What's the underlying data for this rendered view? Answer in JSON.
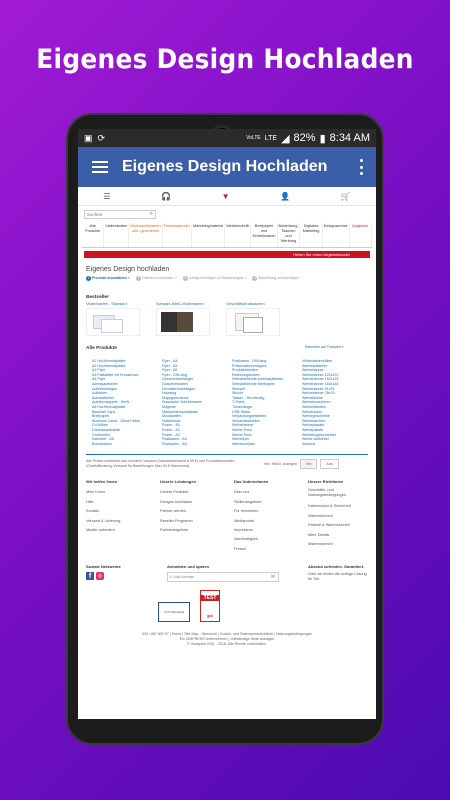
{
  "headline": "Eigenes Design Hochladen",
  "status": {
    "carrier": "VoLTE",
    "net": "LTE",
    "battery": "82%",
    "time": "8:34 AM"
  },
  "appbar": {
    "title": "Eigenes Design Hochladen"
  },
  "web": {
    "search_placeholder": "Suchen",
    "categories": [
      "Alle Produkte",
      "Visitenkarten",
      "Weihnachtskarten und -geschenke",
      "Firmenkalender",
      "Marketingmaterial",
      "Werbetechnik",
      "Briefpapier und Schreibwaren",
      "Bekleidung, Taschen und Werbung",
      "Digitales Marketing",
      "Designservice",
      "Angebote"
    ],
    "promo": "Heben Sie einen Angebotscode!",
    "page_heading": "Eigenes Design hochladen",
    "steps": [
      "Produkt auswählen",
      "Dateien hochladen",
      "Design/Vorlagen & Bestellungen",
      "Bestellung verständigen"
    ],
    "rating_link": "Bewerten auf Trustpilot »",
    "best_title": "Bestseller",
    "best": [
      "Visitenkarten - Standard",
      "Schwarz-Weiß-Visitenkarten",
      "Geschäftsdrucksachen"
    ],
    "all_title": "Alle Produkte",
    "col1": [
      "A1 Hochformatplakte",
      "A2 Hochformatplakte",
      "A3 Flyer",
      "A3 Faltblätter mit Kreuzbruch",
      "A4 Flyer",
      "Adressaufkleber",
      "Aufkleberbögen",
      "Aufkleber",
      "Autoaufkleber",
      "Autotürmagnete - Weiß",
      "A5 Hochformatplakte",
      "Baseball Caps",
      "Briefpapier",
      "Business Cards - Gloss Finish",
      "Cd-Hüllen",
      "Dreiecksaufsteller",
      "Grußkarten",
      "Kalender - A6",
      "Bonuskarten"
    ],
    "col2": [
      "Flyer - A4",
      "Flyer - A5",
      "Flyer - A6",
      "Flyer - DIN lang",
      "Geschenkanhänger",
      "Gutscheinkarten",
      "Hemdkartonbeilagen",
      "Holzartig",
      "Klappgutscheine",
      "Klassische Schreibwaren",
      "Magnete",
      "Markenstempelplakate",
      "Moodkarten",
      "Notizblöcke",
      "Poster - A0",
      "Poster - A1",
      "Poster - A2",
      "Postkarten - A5",
      "Postkarten - A6"
    ],
    "col3": [
      "Postkarten - DIN lang",
      "Präsentationsmappen",
      "Produktetiketten",
      "Rechnungskarten",
      "Selbstklebende Adressaufkleber",
      "Selbstklebende Briefpapier",
      "Stempel",
      "Sticker",
      "Tassen - Rechteckig",
      "T-Shirts",
      "Türanhänger",
      "USB-Sticks",
      "Verpackungsetiketten",
      "Versandaufkleber",
      "Werbebanner",
      "Werbe-Pens",
      "Werbe-Pens",
      "Werbeflyer",
      "Werbeschilder"
    ],
    "col4": [
      "Visitenkartenhüllen",
      "Werbeaufsteller",
      "Werbebanner",
      "Werbebanner 122x122",
      "Werbebanner 152x152",
      "Werbebanner 183x183",
      "Werbebanner 91x91",
      "Werbebanner 76x76",
      "Werbeblöcke",
      "Werbebroschüren",
      "Werbeetiketten",
      "Werbedosen",
      "Werbegeschenke",
      "Werbetaschen",
      "Werbeplakate",
      "Werbepakete",
      "Werbekugelschreiber",
      "Werbe-Aufkleber",
      "Zubehör"
    ],
    "notice": "Alle Preise verstehen sich inklusive Versand (Standardversand à 99 €) und Produktionszeiten (Grafik/Beratung-Versand für Bestellungen über 50 € Warenwert).",
    "price_toggle": {
      "label": "Inkl. MwSt. anzeigen",
      "on": "Ein",
      "off": "Aus"
    },
    "foot": [
      {
        "title": "Wir helfen Ihnen",
        "links": [
          "Mein Konto",
          "Hilfe",
          "Kontakt",
          "Versand & Lieferung",
          "Muster anfordern"
        ]
      },
      {
        "title": "Unsere Leistungen",
        "links": [
          "Unsere Produkte",
          "Designs hochladen",
          "Partner werden",
          "Reseller Programm",
          "Partnerangebote"
        ]
      },
      {
        "title": "Das Unternehmen",
        "links": [
          "Über uns",
          "Stellenangebote",
          "Für Investoren",
          "Mediaportal",
          "Impressum",
          "Nachhaltigkeit",
          "Presse"
        ]
      },
      {
        "title": "Unsere Richtlinien",
        "links": [
          "Geschäfts- und Nutzungsbedingungen",
          "Datenschutz & Sicherheit",
          "Widerrufsrecht",
          "Patente & Warenzeichen",
          "Mehr Details",
          "Widerrufsrecht"
        ]
      }
    ],
    "social_title": "Soziale Netzwerke",
    "signup_title": "Anmelden und sparen",
    "email_placeholder": "E-Mail Adresse",
    "guarantee_title": "Absolut zufrieden. Garantiert.",
    "guarantee_text": "Oder wir finden die richtige Lösung für Sie.",
    "seal_tuv": "TÜV Rheinland",
    "seal_test": "TEST",
    "seal_grade": "gut",
    "legal_1": "030 / 887 892 57 | Home | Site Map - Übersicht | Cookie- und Datenschutzrichtlinie | Nutzungsbedingungen",
    "legal_2": "Ein CIMPRESS Unternehmen | Vollständige Seite anzeigen",
    "legal_3": "© Vistaprint 2001 - 2018. Alle Rechte vorbehalten."
  }
}
